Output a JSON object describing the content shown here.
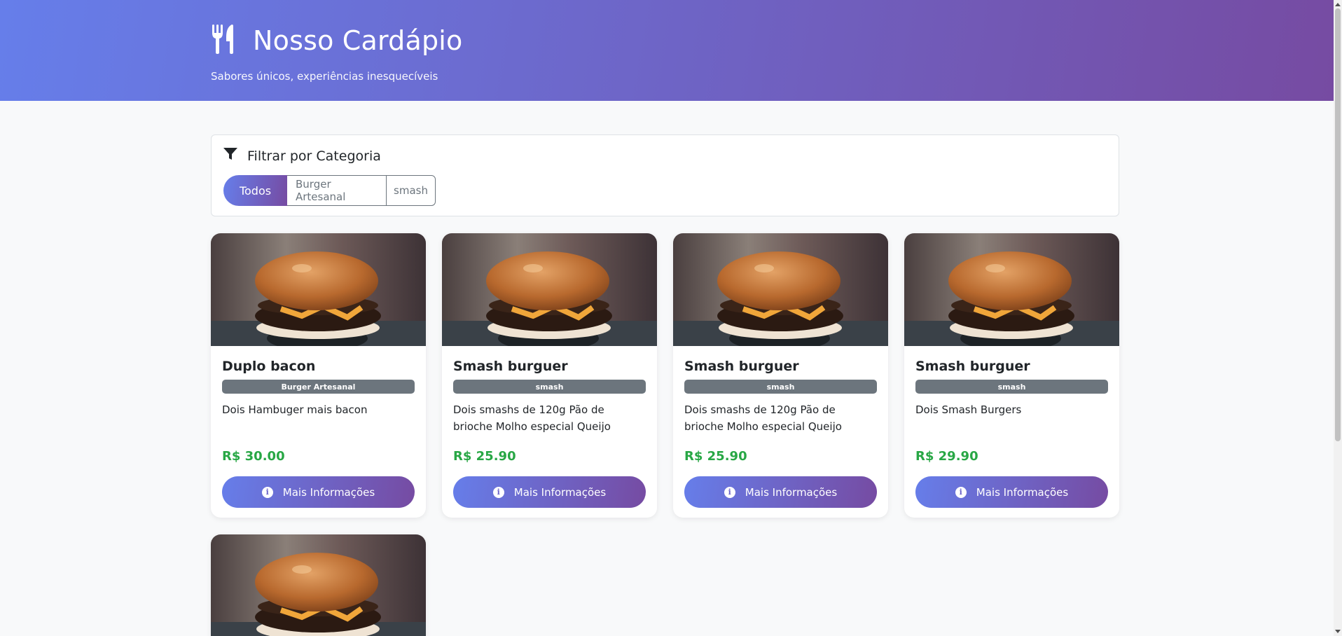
{
  "header": {
    "title": "Nosso Cardápio",
    "subtitle": "Sabores únicos, experiências inesquecíveis",
    "icon": "utensils-icon"
  },
  "filter": {
    "heading": "Filtrar por Categoria",
    "icon": "filter-icon",
    "options": [
      "Todos",
      "Burger Artesanal",
      "smash"
    ],
    "selected": "Todos"
  },
  "products": [
    {
      "name": "Duplo bacon",
      "category": "Burger Artesanal",
      "description": "Dois Hambuger mais bacon",
      "price": "R$ 30.00",
      "button": "Mais Informações"
    },
    {
      "name": "Smash burguer",
      "category": "smash",
      "description": "Dois smashs de 120g Pão de brioche Molho especial Queijo",
      "price": "R$ 25.90",
      "button": "Mais Informações"
    },
    {
      "name": "Smash burguer",
      "category": "smash",
      "description": "Dois smashs de 120g Pão de brioche Molho especial Queijo",
      "price": "R$ 25.90",
      "button": "Mais Informações"
    },
    {
      "name": "Smash burguer",
      "category": "smash",
      "description": "Dois Smash Burgers",
      "price": "R$ 29.90",
      "button": "Mais Informações"
    }
  ],
  "colors": {
    "gradient_start": "#667eea",
    "gradient_end": "#764ba2",
    "price": "#28a745",
    "badge": "#6c757d"
  }
}
